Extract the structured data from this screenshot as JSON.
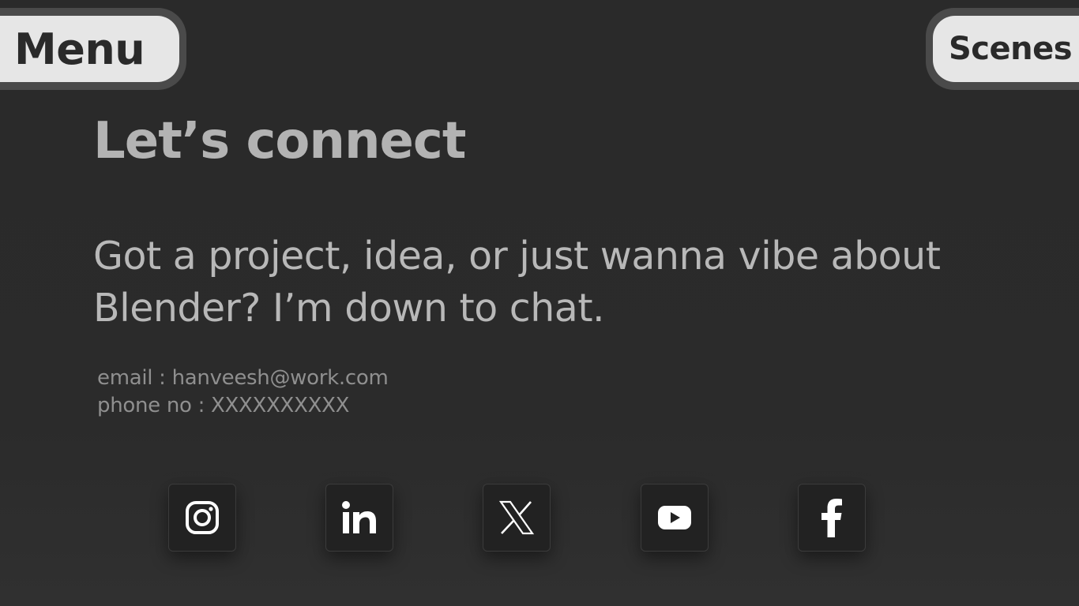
{
  "nav": {
    "menu_label": "Menu",
    "scenes_label": "Scenes"
  },
  "contact_section": {
    "title": "Let’s connect",
    "tagline": "Got a project, idea, or just wanna vibe about Blender? I’m down to chat.",
    "email_line": "email : hanveesh@work.com",
    "phone_line": "phone no : XXXXXXXXXX"
  },
  "socials": [
    {
      "icon": "instagram-icon"
    },
    {
      "icon": "linkedin-icon"
    },
    {
      "icon": "x-icon"
    },
    {
      "icon": "youtube-icon"
    },
    {
      "icon": "facebook-icon"
    }
  ],
  "colors": {
    "background": "#2a2a2a",
    "pill_fill": "#e6e6e6",
    "pill_border": "#4a4a4a",
    "heading_text": "#b3b3b3",
    "contact_text": "#8f8f8f",
    "tile_bg": "#222222",
    "icon": "#ffffff"
  }
}
